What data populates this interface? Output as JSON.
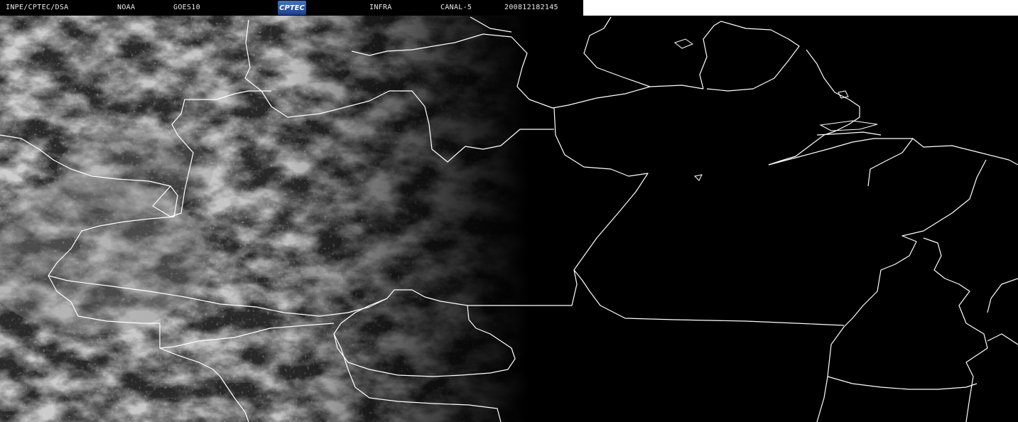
{
  "header": {
    "agency": "INPE/CPTEC/DSA",
    "provider": "NOAA",
    "satellite": "GOES10",
    "logo_text": "CPTEC",
    "product": "INFRA",
    "channel": "CANAL-5",
    "timestamp": "200812182145"
  },
  "colors": {
    "background": "#000000",
    "border_lines": "#ffffff",
    "cloud_tone": "#9a9a9a"
  }
}
